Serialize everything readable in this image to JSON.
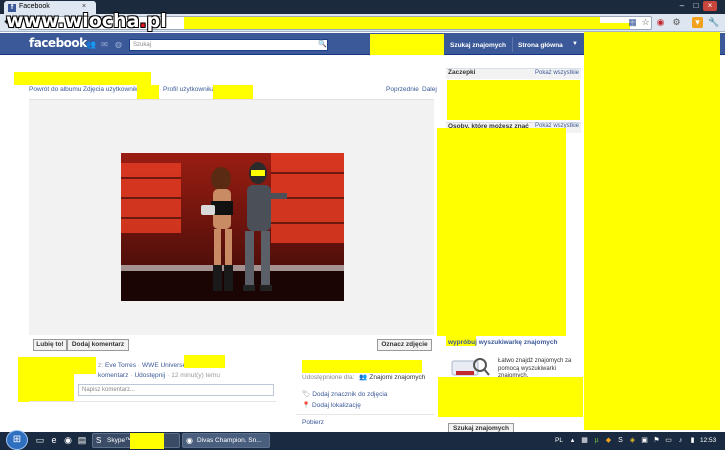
{
  "browser": {
    "tab_title": "Facebook",
    "tab_close": "×",
    "window_buttons": [
      "–",
      "□",
      "×"
    ],
    "watermark": {
      "prefix": "www.wiocha",
      "dot": ".",
      "suffix": "pl"
    }
  },
  "fb": {
    "logo": "facebook",
    "search_placeholder": "Szukaj",
    "nav": {
      "find_friends": "Szukaj znajomych",
      "home": "Strona główna"
    }
  },
  "album": {
    "back_to_album": "Powrót do albumu",
    "user_photos": "Zdjęcia użytkownika",
    "user_profile": "Profil użytkownika",
    "previous": "Poprzednie",
    "next": "Dalej",
    "separator": "·"
  },
  "actions": {
    "like": "Lubię to!",
    "add_comment": "Dodaj komentarz",
    "tag_photo": "Oznacz zdjęcie"
  },
  "photo_meta": {
    "with_prefix": "z:",
    "tagged_person": "Eve Torres",
    "separator": "·",
    "album_name": "WWE Universe",
    "comment_link": "komentarz",
    "share_link": "Udostępnij",
    "time": "12 minut(y) temu",
    "comment_placeholder": "Napisz komentarz..."
  },
  "right_meta": {
    "shared_with_label": "Udostępnione dla:",
    "shared_with_value": "Znajomi znajomych",
    "add_bookmark": "Dodaj znacznik do zdjęcia",
    "add_location": "Dodaj lokalizację",
    "download": "Pobierz"
  },
  "sidebar": {
    "pokes_title": "Zaczepki",
    "show_all": "Pokaż wszystkie",
    "people_title": "Osoby, które możesz znać",
    "finder_title": "wypróbuj wyszukiwarkę znajomych",
    "finder_body": "Łatwo znajdź znajomych za pomocą wyszukiwarki znajomych.",
    "find_friends_btn": "Szukaj znajomych"
  },
  "taskbar": {
    "skype_label": "Skype™",
    "chrome_label": "Divas Champion. Sn...",
    "lang": "PL",
    "clock": "12:53"
  },
  "colors": {
    "fb_blue": "#3b5998",
    "redaction_yellow": "#ffff00",
    "taskbar": "#1a2a40"
  }
}
